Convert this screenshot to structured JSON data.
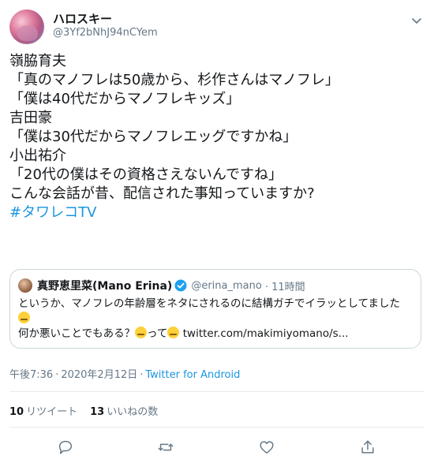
{
  "user": {
    "display_name": "ハロスキー",
    "screen_name": "@3Yf2bNhJ94nCYem",
    "avatar_icon": "user-avatar"
  },
  "tweet": {
    "lines": [
      "嶺脇育夫",
      "「真のマノフレは50歳から、杉作さんはマノフレ」",
      "「僕は40代だからマノフレキッズ」",
      "吉田豪",
      "「僕は30代だからマノフレエッグですかね」",
      "小出祐介",
      "「20代の僕はその資格さえないんですね」",
      "こんな会話が昔、配信された事知っていますか?"
    ],
    "hashtag": "#タワレコTV"
  },
  "quote": {
    "name": "真野恵里菜(Mano Erina)",
    "handle": "@erina_mano",
    "time": "· 11時間",
    "line1": "というか、マノフレの年齢層をネタにされるのに結構ガチでイラッとしてました",
    "line3_pre": "何か悪いことでもある？",
    "line3_mid": "って",
    "line3_link": "twitter.com/makimiyomano/s..."
  },
  "meta": {
    "time": "午後7:36",
    "sep": "·",
    "date": "2020年2月12日",
    "client": "Twitter for Android"
  },
  "stats": {
    "retweets_count": "10",
    "retweets_label": "リツイート",
    "likes_count": "13",
    "likes_label": "いいねの数"
  },
  "colors": {
    "link": "#1b95e0",
    "secondary_text": "#657786",
    "border": "#e6ecf0"
  }
}
